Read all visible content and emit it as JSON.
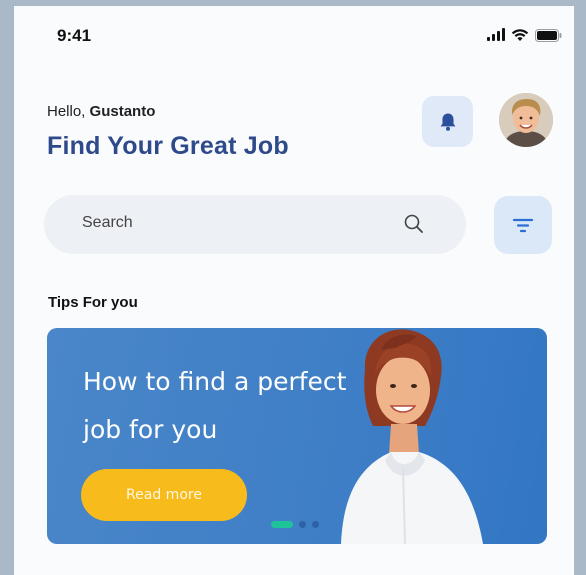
{
  "status_bar": {
    "time": "9:41",
    "icons": [
      "signal-icon",
      "wifi-icon",
      "battery-icon"
    ]
  },
  "header": {
    "greeting_prefix": "Hello, ",
    "user_name": "Gustanto",
    "title": "Find Your Great Job",
    "title_color": "#2f4a8a",
    "notification_icon": "bell-icon",
    "avatar_icon": "user-avatar"
  },
  "search": {
    "placeholder": "Search",
    "icon": "search-icon",
    "filter_icon": "filter-icon"
  },
  "tips": {
    "section_title": "Tips For you",
    "card": {
      "headline": "How to find a perfect job for you",
      "button_label": "Read more",
      "button_color": "#f7bb1c",
      "background_color": "#3f7fc6",
      "carousel": {
        "total_pages": 3,
        "active_page": 1
      }
    }
  }
}
